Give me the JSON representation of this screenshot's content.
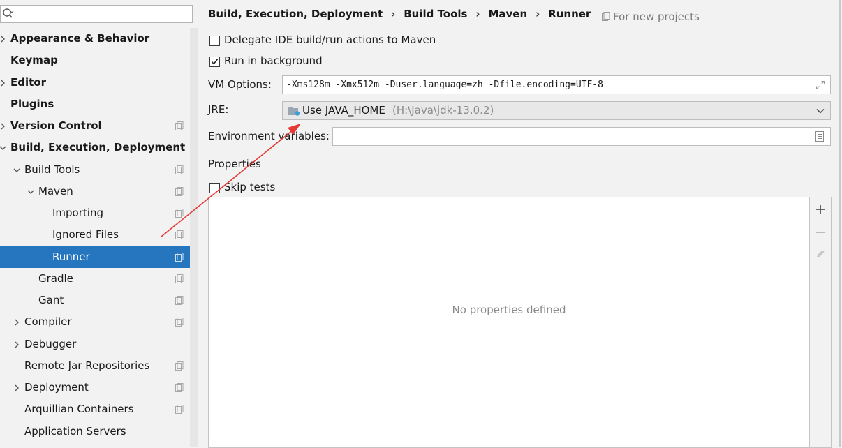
{
  "search": {
    "value": "",
    "placeholder": ""
  },
  "sidebar": {
    "items": [
      {
        "label": "Appearance & Behavior",
        "bold": true,
        "level": 0,
        "arrow": "right",
        "proj": false,
        "selected": false
      },
      {
        "label": "Keymap",
        "bold": true,
        "level": 0,
        "arrow": "none",
        "proj": false,
        "selected": false
      },
      {
        "label": "Editor",
        "bold": true,
        "level": 0,
        "arrow": "right",
        "proj": false,
        "selected": false
      },
      {
        "label": "Plugins",
        "bold": true,
        "level": 0,
        "arrow": "none",
        "proj": false,
        "selected": false
      },
      {
        "label": "Version Control",
        "bold": true,
        "level": 0,
        "arrow": "right",
        "proj": true,
        "selected": false
      },
      {
        "label": "Build, Execution, Deployment",
        "bold": true,
        "level": 0,
        "arrow": "down",
        "proj": false,
        "selected": false
      },
      {
        "label": "Build Tools",
        "bold": false,
        "level": 1,
        "arrow": "down",
        "proj": true,
        "selected": false
      },
      {
        "label": "Maven",
        "bold": false,
        "level": 2,
        "arrow": "down",
        "proj": true,
        "selected": false
      },
      {
        "label": "Importing",
        "bold": false,
        "level": 3,
        "arrow": "none",
        "proj": true,
        "selected": false
      },
      {
        "label": "Ignored Files",
        "bold": false,
        "level": 3,
        "arrow": "none",
        "proj": true,
        "selected": false
      },
      {
        "label": "Runner",
        "bold": false,
        "level": 3,
        "arrow": "none",
        "proj": true,
        "selected": true
      },
      {
        "label": "Gradle",
        "bold": false,
        "level": 2,
        "arrow": "none",
        "proj": true,
        "selected": false
      },
      {
        "label": "Gant",
        "bold": false,
        "level": 2,
        "arrow": "none",
        "proj": true,
        "selected": false
      },
      {
        "label": "Compiler",
        "bold": false,
        "level": 1,
        "arrow": "right",
        "proj": true,
        "selected": false
      },
      {
        "label": "Debugger",
        "bold": false,
        "level": 1,
        "arrow": "right",
        "proj": false,
        "selected": false
      },
      {
        "label": "Remote Jar Repositories",
        "bold": false,
        "level": 1,
        "arrow": "none",
        "proj": true,
        "selected": false
      },
      {
        "label": "Deployment",
        "bold": false,
        "level": 1,
        "arrow": "right",
        "proj": true,
        "selected": false
      },
      {
        "label": "Arquillian Containers",
        "bold": false,
        "level": 1,
        "arrow": "none",
        "proj": true,
        "selected": false
      },
      {
        "label": "Application Servers",
        "bold": false,
        "level": 1,
        "arrow": "none",
        "proj": false,
        "selected": false
      }
    ]
  },
  "breadcrumb": {
    "items": [
      "Build, Execution, Deployment",
      "Build Tools",
      "Maven",
      "Runner"
    ],
    "separator": "›"
  },
  "for_new_projects": "For new projects",
  "delegate": {
    "label": "Delegate IDE build/run actions to Maven",
    "checked": false
  },
  "background": {
    "label": "Run in background",
    "checked": true
  },
  "vm_options": {
    "label": "VM Options:",
    "value": "-Xms128m -Xmx512m -Duser.language=zh -Dfile.encoding=UTF-8"
  },
  "jre": {
    "label": "JRE:",
    "value": "Use JAVA_HOME",
    "path": "(H:\\Java\\jdk-13.0.2)"
  },
  "env_vars": {
    "label": "Environment variables:",
    "value": ""
  },
  "properties": {
    "title": "Properties",
    "empty_text": "No properties defined"
  },
  "skip_tests": {
    "label": "Skip tests",
    "checked": false
  },
  "colors": {
    "accent": "#2675bf",
    "annotation_arrow": "#e53935"
  }
}
